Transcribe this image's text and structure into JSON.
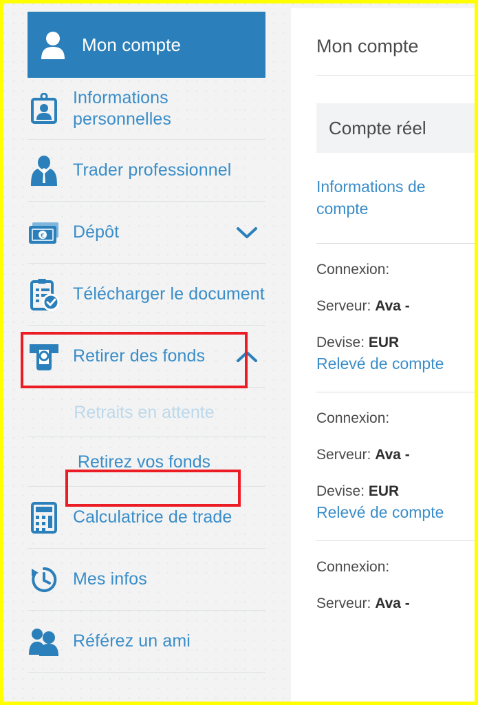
{
  "sidebar": {
    "items": [
      {
        "label": "Mon compte",
        "icon": "user-icon",
        "state": "active"
      },
      {
        "label": "Informations personnelles",
        "icon": "id-card-icon",
        "state": "normal"
      },
      {
        "label": "Trader professionnel",
        "icon": "businessman-icon",
        "state": "normal"
      },
      {
        "label": "Dépôt",
        "icon": "banknotes-icon",
        "state": "normal",
        "chevron": "chevron-down"
      },
      {
        "label": "Télécharger le document",
        "icon": "document-check-icon",
        "state": "normal"
      },
      {
        "label": "Retirer des fonds",
        "icon": "atm-withdraw-icon",
        "state": "normal",
        "chevron": "chevron-up",
        "highlighted": true
      },
      {
        "label": "Calculatrice de trade",
        "icon": "calculator-icon",
        "state": "normal"
      },
      {
        "label": "Mes infos",
        "icon": "history-clock-icon",
        "state": "normal"
      },
      {
        "label": "Référez un ami",
        "icon": "refer-friend-icon",
        "state": "normal"
      }
    ],
    "sub_items": [
      {
        "label": "Retraits en attente",
        "state": "disabled"
      },
      {
        "label": "Retirez vos fonds",
        "state": "normal",
        "highlighted": true
      }
    ]
  },
  "right_panel": {
    "title": "Mon compte",
    "account_tab": "Compte réel",
    "account_info_link": "Informations de compte",
    "accounts": [
      {
        "connexion_label": "Connexion:",
        "connexion_value": "",
        "serveur_label": "Serveur:",
        "serveur_value": "Ava -",
        "devise_label": "Devise:",
        "devise_value": "EUR",
        "statement_link": "Relevé de compte"
      },
      {
        "connexion_label": "Connexion:",
        "connexion_value": "",
        "serveur_label": "Serveur:",
        "serveur_value": "Ava -",
        "devise_label": "Devise:",
        "devise_value": "EUR",
        "statement_link": "Relevé de compte"
      },
      {
        "connexion_label": "Connexion:",
        "connexion_value": "",
        "serveur_label": "Serveur:",
        "serveur_value": "Ava -",
        "devise_label": "",
        "devise_value": "",
        "statement_link": ""
      }
    ]
  },
  "colors": {
    "accent_blue": "#2b7fba",
    "link_blue": "#3a8dc9",
    "highlight_red": "#ec1c24",
    "screenshot_border": "#ffff00",
    "sidebar_bg": "#f2f3f2",
    "disabled_blue": "#bdd8ec"
  }
}
